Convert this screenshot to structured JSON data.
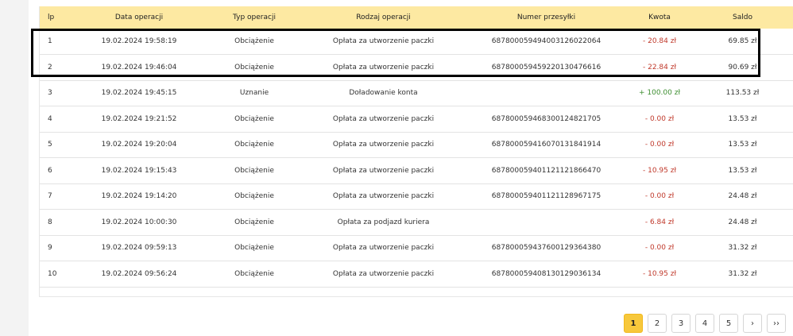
{
  "table": {
    "headers": [
      "lp",
      "Data operacji",
      "Typ operacji",
      "Rodzaj operacji",
      "Numer przesyłki",
      "Kwota",
      "Saldo"
    ],
    "rows": [
      {
        "lp": "1",
        "date": "19.02.2024 19:58:19",
        "type": "Obciążenie",
        "kind": "Opłata za utworzenie paczki",
        "tracking": "687800059494003126022064",
        "amount": "- 20.84 zł",
        "balance": "69.85 zł",
        "amount_sign": "neg"
      },
      {
        "lp": "2",
        "date": "19.02.2024 19:46:04",
        "type": "Obciążenie",
        "kind": "Opłata za utworzenie paczki",
        "tracking": "687800059459220130476616",
        "amount": "- 22.84 zł",
        "balance": "90.69 zł",
        "amount_sign": "neg"
      },
      {
        "lp": "3",
        "date": "19.02.2024 19:45:15",
        "type": "Uznanie",
        "kind": "Doładowanie konta",
        "tracking": "",
        "amount": "+ 100.00 zł",
        "balance": "113.53 zł",
        "amount_sign": "pos"
      },
      {
        "lp": "4",
        "date": "19.02.2024 19:21:52",
        "type": "Obciążenie",
        "kind": "Opłata za utworzenie paczki",
        "tracking": "687800059468300124821705",
        "amount": "- 0.00 zł",
        "balance": "13.53 zł",
        "amount_sign": "neg"
      },
      {
        "lp": "5",
        "date": "19.02.2024 19:20:04",
        "type": "Obciążenie",
        "kind": "Opłata za utworzenie paczki",
        "tracking": "687800059416070131841914",
        "amount": "- 0.00 zł",
        "balance": "13.53 zł",
        "amount_sign": "neg"
      },
      {
        "lp": "6",
        "date": "19.02.2024 19:15:43",
        "type": "Obciążenie",
        "kind": "Opłata za utworzenie paczki",
        "tracking": "687800059401121121866470",
        "amount": "- 10.95 zł",
        "balance": "13.53 zł",
        "amount_sign": "neg"
      },
      {
        "lp": "7",
        "date": "19.02.2024 19:14:20",
        "type": "Obciążenie",
        "kind": "Opłata za utworzenie paczki",
        "tracking": "687800059401121128967175",
        "amount": "- 0.00 zł",
        "balance": "24.48 zł",
        "amount_sign": "neg"
      },
      {
        "lp": "8",
        "date": "19.02.2024 10:00:30",
        "type": "Obciążenie",
        "kind": "Opłata za podjazd kuriera",
        "tracking": "",
        "amount": "- 6.84 zł",
        "balance": "24.48 zł",
        "amount_sign": "neg"
      },
      {
        "lp": "9",
        "date": "19.02.2024 09:59:13",
        "type": "Obciążenie",
        "kind": "Opłata za utworzenie paczki",
        "tracking": "687800059437600129364380",
        "amount": "- 0.00 zł",
        "balance": "31.32 zł",
        "amount_sign": "neg"
      },
      {
        "lp": "10",
        "date": "19.02.2024 09:56:24",
        "type": "Obciążenie",
        "kind": "Opłata za utworzenie paczki",
        "tracking": "687800059408130129036134",
        "amount": "- 10.95 zł",
        "balance": "31.32 zł",
        "amount_sign": "neg"
      }
    ]
  },
  "pagination": {
    "pages": [
      "1",
      "2",
      "3",
      "4",
      "5"
    ],
    "active": "1",
    "next": "›",
    "last": "››"
  },
  "colors": {
    "header_bg": "#fde9a2",
    "negative": "#c0392b",
    "positive": "#3c8d2f",
    "active_page": "#f7c83b"
  }
}
